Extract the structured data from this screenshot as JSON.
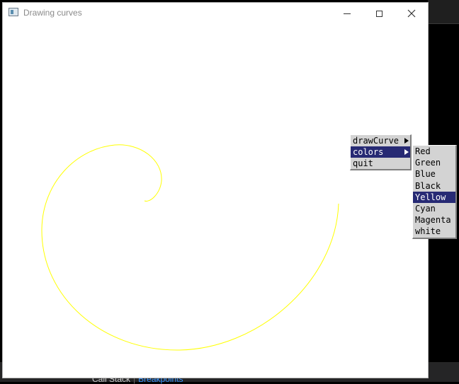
{
  "window": {
    "title": "Drawing curves",
    "controls": {
      "minimize": "minimize",
      "maximize": "maximize",
      "close": "close"
    }
  },
  "curve": {
    "color": "#ffff00",
    "type": "spiral"
  },
  "menu": {
    "items": [
      {
        "label": "drawCurve",
        "has_submenu": true,
        "selected": false
      },
      {
        "label": "colors",
        "has_submenu": true,
        "selected": true
      },
      {
        "label": "quit",
        "has_submenu": false,
        "selected": false
      }
    ],
    "submenu_colors": [
      {
        "label": "Red",
        "selected": false
      },
      {
        "label": "Green",
        "selected": false
      },
      {
        "label": "Blue",
        "selected": false
      },
      {
        "label": "Black",
        "selected": false
      },
      {
        "label": "Yellow",
        "selected": true
      },
      {
        "label": "Cyan",
        "selected": false
      },
      {
        "label": "Magenta",
        "selected": false
      },
      {
        "label": "white",
        "selected": false
      }
    ],
    "selected_color": "#272a74"
  },
  "background_panel": {
    "tab_call_stack": "Call Stack",
    "tab_breakpoints": "Breakpoints"
  }
}
